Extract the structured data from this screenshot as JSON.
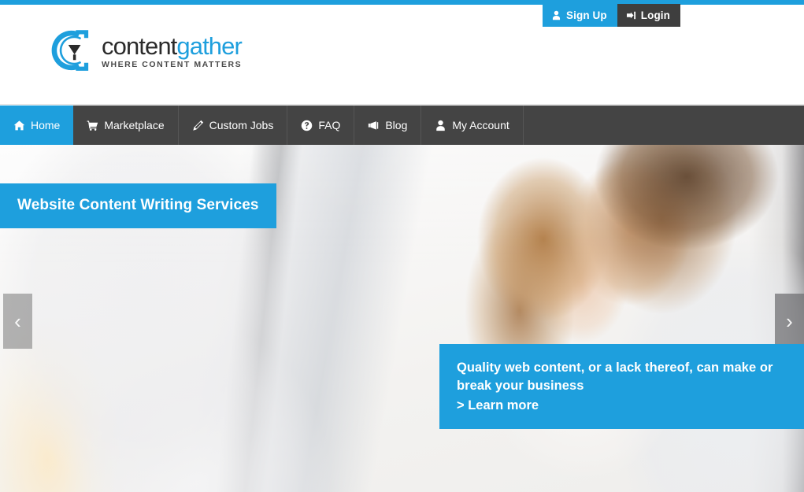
{
  "theme": {
    "accent_blue": "#1e9fdd",
    "nav_dark": "#444444",
    "login_dark": "#3e3e3e",
    "logo_dark": "#2b2b2b"
  },
  "header": {
    "logo": {
      "word_dark": "content",
      "word_blue": "gather",
      "tagline": "WHERE CONTENT MATTERS",
      "mark_icon": "contentgather-c-funnel-logo-icon"
    },
    "auth": {
      "signup_label": "Sign Up",
      "signup_icon": "user-icon",
      "login_label": "Login",
      "login_icon": "sign-in-icon"
    }
  },
  "nav": {
    "items": [
      {
        "label": "Home",
        "icon": "home-icon",
        "active": true
      },
      {
        "label": "Marketplace",
        "icon": "shopping-cart-icon",
        "active": false
      },
      {
        "label": "Custom Jobs",
        "icon": "pencil-icon",
        "active": false
      },
      {
        "label": "FAQ",
        "icon": "question-circle-icon",
        "active": false
      },
      {
        "label": "Blog",
        "icon": "bullhorn-icon",
        "active": false
      },
      {
        "label": "My Account",
        "icon": "user-icon",
        "active": false
      }
    ]
  },
  "hero": {
    "slide_title": "Website Content Writing Services",
    "caption_text": "Quality web content, or a lack thereof, can make or break your business",
    "caption_link": "> Learn more",
    "prev_icon": "chevron-left-icon",
    "prev_glyph": "‹",
    "next_icon": "chevron-right-icon",
    "next_glyph": "›"
  }
}
